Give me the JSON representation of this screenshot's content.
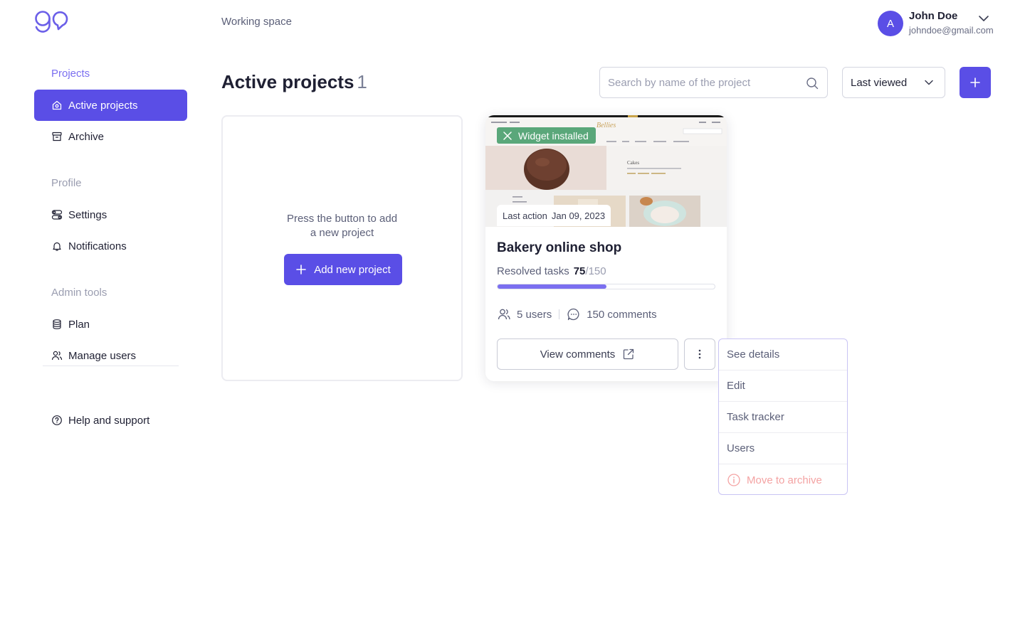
{
  "header": {
    "logo_icon": "go-logo",
    "workspace": "Working space",
    "user": {
      "initial": "A",
      "name": "John Doe",
      "email": "johndoe@gmail.com"
    }
  },
  "sidebar": {
    "sections": [
      {
        "label": "Projects",
        "items": [
          {
            "label": "Active projects",
            "icon": "home-icon",
            "active": true
          },
          {
            "label": "Archive",
            "icon": "archive-icon"
          }
        ]
      },
      {
        "label": "Profile",
        "items": [
          {
            "label": "Settings",
            "icon": "toggles-icon"
          },
          {
            "label": "Notifications",
            "icon": "bell-icon"
          }
        ]
      },
      {
        "label": "Admin tools",
        "items": [
          {
            "label": "Plan",
            "icon": "database-icon"
          },
          {
            "label": "Manage users",
            "icon": "users-icon"
          }
        ]
      }
    ],
    "help": {
      "label": "Help and support",
      "icon": "help-circle-icon"
    }
  },
  "main": {
    "title": "Active projects",
    "count": "1",
    "search": {
      "placeholder": "Search by name of the project",
      "value": ""
    },
    "sort": {
      "selected": "Last viewed"
    },
    "empty_card": {
      "text_line1": "Press the button to add",
      "text_line2": "a new project",
      "button": "Add new project"
    },
    "project": {
      "badge": "Widget installed",
      "last_action_label": "Last action",
      "last_action_date": "Jan 09, 2023",
      "title": "Bakery online shop",
      "tasks_label": "Resolved tasks",
      "tasks_done": "75",
      "tasks_total": "/150",
      "progress_fraction": 0.5,
      "users": "5 users",
      "comments": "150 comments",
      "view_comments": "View comments"
    },
    "menu": {
      "items": [
        "See details",
        "Edit",
        "Task tracker",
        "Users"
      ],
      "danger_item": "Move to archive"
    }
  },
  "colors": {
    "accent": "#5a4ee6",
    "accent_light": "#7b6ff0",
    "badge_green": "#5aa77a",
    "danger": "#f4a3a3"
  }
}
